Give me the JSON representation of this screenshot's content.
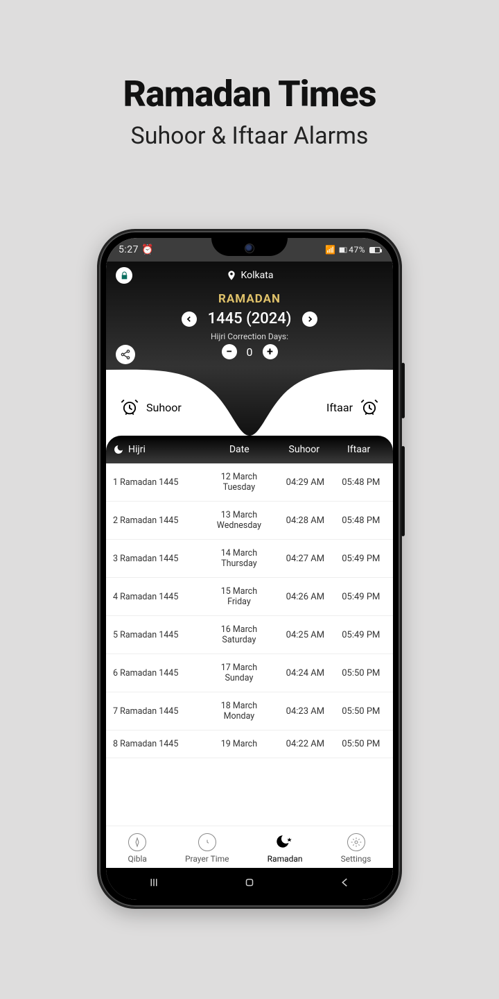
{
  "promo": {
    "title": "Ramadan Times",
    "subtitle": "Suhoor & Iftaar Alarms"
  },
  "statusbar": {
    "time": "5:27",
    "battery_pct": "47%"
  },
  "header": {
    "location": "Kolkata",
    "ramadan_label": "RAMADAN",
    "year": "1445 (2024)",
    "hijri_correction_label": "Hijri Correction Days:",
    "hijri_correction_value": "0"
  },
  "alarms": {
    "suhoor_label": "Suhoor",
    "iftaar_label": "Iftaar"
  },
  "table": {
    "col_hijri": "Hijri",
    "col_date": "Date",
    "col_suhoor": "Suhoor",
    "col_iftaar": "Iftaar",
    "rows": [
      {
        "hijri": "1 Ramadan 1445",
        "date": "12 March Tuesday",
        "suhoor": "04:29 AM",
        "iftaar": "05:48 PM"
      },
      {
        "hijri": "2 Ramadan 1445",
        "date": "13 March Wednesday",
        "suhoor": "04:28 AM",
        "iftaar": "05:48 PM"
      },
      {
        "hijri": "3 Ramadan 1445",
        "date": "14 March Thursday",
        "suhoor": "04:27 AM",
        "iftaar": "05:49 PM"
      },
      {
        "hijri": "4 Ramadan 1445",
        "date": "15 March Friday",
        "suhoor": "04:26 AM",
        "iftaar": "05:49 PM"
      },
      {
        "hijri": "5 Ramadan 1445",
        "date": "16 March Saturday",
        "suhoor": "04:25 AM",
        "iftaar": "05:49 PM"
      },
      {
        "hijri": "6 Ramadan 1445",
        "date": "17 March Sunday",
        "suhoor": "04:24 AM",
        "iftaar": "05:50 PM"
      },
      {
        "hijri": "7 Ramadan 1445",
        "date": "18 March Monday",
        "suhoor": "04:23 AM",
        "iftaar": "05:50 PM"
      },
      {
        "hijri": "8 Ramadan 1445",
        "date": "19 March",
        "suhoor": "04:22 AM",
        "iftaar": "05:50 PM"
      }
    ]
  },
  "nav": {
    "qibla": "Qibla",
    "prayer": "Prayer Time",
    "ramadan": "Ramadan",
    "settings": "Settings"
  }
}
